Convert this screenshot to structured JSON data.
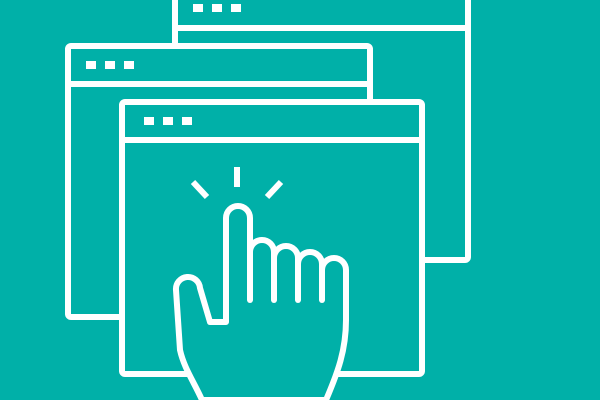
{
  "illustration": {
    "background_color": "#00b0a8",
    "line_color": "#ffffff",
    "windows": [
      {
        "name": "back-window",
        "title_dots": 3
      },
      {
        "name": "middle-window",
        "title_dots": 3
      },
      {
        "name": "front-window",
        "title_dots": 3
      }
    ],
    "pointer": {
      "icon": "hand-pointer-icon",
      "click_rays": 3
    }
  }
}
